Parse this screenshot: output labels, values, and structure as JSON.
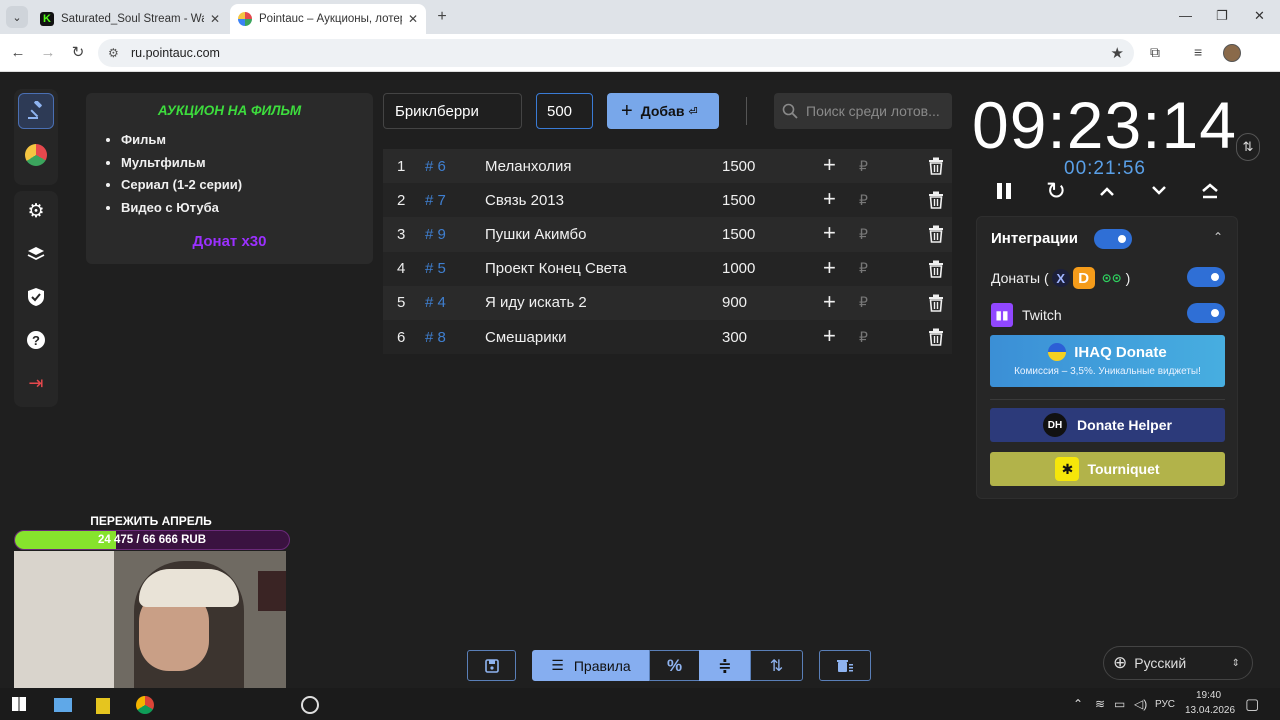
{
  "browser": {
    "tabs": [
      {
        "title": "Saturated_Soul Stream - Watch",
        "active": false
      },
      {
        "title": "Pointauc – Аукционы, лотереи",
        "active": true
      }
    ],
    "url": "ru.pointauc.com"
  },
  "rules_card": {
    "title": "АУКЦИОН НА ФИЛЬМ",
    "items": [
      "Фильм",
      "Мультфильм",
      "Сериал (1-2 серии)",
      "Видео с Ютуба"
    ],
    "donate_multiplier": "Донат х30"
  },
  "lot_form": {
    "name_value": "Бриклберри",
    "amount_value": "500",
    "add_button_label": "Добав",
    "search_placeholder": "Поиск среди лотов..."
  },
  "lots": [
    {
      "index": "1",
      "id": "# 6",
      "name": "Меланхолия",
      "amount": "1500"
    },
    {
      "index": "2",
      "id": "# 7",
      "name": "Связь 2013",
      "amount": "1500"
    },
    {
      "index": "3",
      "id": "# 9",
      "name": "Пушки Акимбо",
      "amount": "1500"
    },
    {
      "index": "4",
      "id": "# 5",
      "name": "Проект Конец Света",
      "amount": "1000"
    },
    {
      "index": "5",
      "id": "# 4",
      "name": "Я иду искать 2",
      "amount": "900"
    },
    {
      "index": "6",
      "id": "# 8",
      "name": "Смешарики",
      "amount": "300"
    }
  ],
  "currency_symbol": "₽",
  "timer": {
    "main": "09:23:14",
    "sub": "00:21:56"
  },
  "integrations": {
    "title": "Интеграции",
    "donations_label_start": "Донаты (",
    "donations_label_end": ")",
    "twitch_label": "Twitch",
    "ihaq_title": "IHAQ Donate",
    "ihaq_subtitle": "Комиссия – 3,5%. Уникальные виджеты!",
    "donate_helper": "Donate Helper",
    "tourniquet": "Tourniquet",
    "enabled": true,
    "donations_enabled": true,
    "twitch_enabled": true
  },
  "goal": {
    "title": "ПЕРЕЖИТЬ АПРЕЛЬ",
    "progress_text": "24 475 / 66 666 RUB",
    "progress_fraction": 0.367
  },
  "bottom_toolbar": {
    "rules_label": "Правила"
  },
  "language": "Русский",
  "taskbar": {
    "lang": "РУС",
    "time": "19:40",
    "date": "13.04.2026"
  },
  "colors": {
    "accent": "#78a7ea",
    "lot_id": "#3f7fd0",
    "rules_title": "#3ddc3d",
    "donate_multiplier": "#9b30ff",
    "timer_sub": "#5aa0e8",
    "goal_fill": "#86e32d"
  }
}
